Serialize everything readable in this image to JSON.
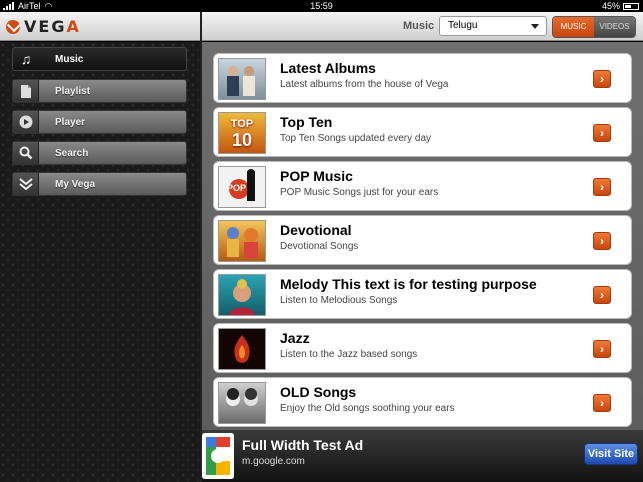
{
  "status_bar": {
    "carrier": "AirTel",
    "time": "15:59",
    "battery": "45%"
  },
  "header": {
    "logo_text_a": "VEG",
    "logo_text_b": "A",
    "language_label": "Music",
    "language_selected": "Telugu",
    "toggle": {
      "music": "MUSIC",
      "videos": "VIDEOS",
      "active": "music"
    }
  },
  "sidebar": {
    "items": [
      {
        "label": "Music",
        "icon": "music-note-icon",
        "active": true
      },
      {
        "label": "Playlist",
        "icon": "playlist-icon",
        "active": false
      },
      {
        "label": "Player",
        "icon": "play-icon",
        "active": false
      },
      {
        "label": "Search",
        "icon": "search-icon",
        "active": false
      },
      {
        "label": "My Vega",
        "icon": "my-vega-icon",
        "active": false
      }
    ]
  },
  "list": [
    {
      "title": "Latest Albums",
      "subtitle": "Latest albums from the house of Vega",
      "thumb_color": "#8fa3b3"
    },
    {
      "title": "Top Ten",
      "subtitle": "Top Ten Songs updated every day",
      "thumb_color": "#e8a01c"
    },
    {
      "title": "POP Music",
      "subtitle": "POP Music Songs just for your ears",
      "thumb_color": "#f2f2f2"
    },
    {
      "title": "Devotional",
      "subtitle": "Devotional Songs",
      "thumb_color": "#c9821e"
    },
    {
      "title": "Melody This text is for testing purpose",
      "subtitle": "Listen to Melodious Songs",
      "thumb_color": "#1f8a9a"
    },
    {
      "title": "Jazz",
      "subtitle": "Listen to the Jazz based songs",
      "thumb_color": "#1a0a0a"
    },
    {
      "title": "OLD Songs",
      "subtitle": "Enjoy the Old songs soothing your ears",
      "thumb_color": "#9a9a9a"
    }
  ],
  "thumb_text": {
    "top_ten_a": "TOP",
    "top_ten_b": "10",
    "pop": "POP"
  },
  "ad": {
    "title": "Full Width Test Ad",
    "url": "m.google.com",
    "button": "Visit Site"
  },
  "colors": {
    "accent": "#d24a13",
    "ad_button": "#2a5cc4"
  }
}
